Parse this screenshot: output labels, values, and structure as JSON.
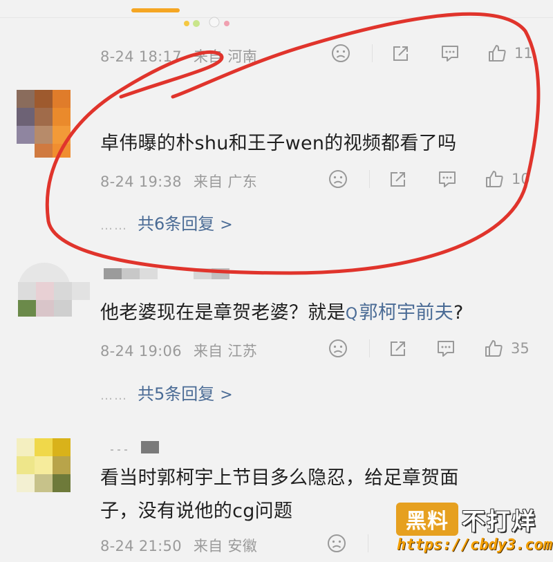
{
  "comments": [
    {
      "date": "8-24 18:17",
      "location": "来自 河南",
      "likes": "11"
    },
    {
      "text": "卓伟曝的朴shu和王子wen的视频都看了吗",
      "date": "8-24 19:38",
      "location": "来自 广东",
      "likes": "10",
      "replies": "共6条回复"
    },
    {
      "text_before": "他老婆现在是章贺老婆？就是",
      "linked_name": "郭柯宇前夫",
      "text_after": "?",
      "date": "8-24 19:06",
      "location": "来自 江苏",
      "likes": "35",
      "replies": "共5条回复"
    },
    {
      "text_line1": "看当时郭柯宇上节目多么隐忍，给足章贺面",
      "text_line2": "子，没有说他的cg问题",
      "date": "8-24 21:50",
      "location": "来自 安徽"
    }
  ],
  "reply_dots": "……",
  "reply_chevron": ">",
  "search_glyph": "Q",
  "watermark": {
    "badge": "黑料",
    "text": "不打烊",
    "url": "https://cbdy3.com"
  },
  "icons": [
    "dislike-face-icon",
    "share-icon",
    "comment-icon",
    "thumbs-up-icon"
  ],
  "colors": {
    "background": "#f2f2f2",
    "link": "#4a6b95",
    "meta": "#9a9a9a",
    "annotation": "#e0342c",
    "watermark": "#e6a020"
  }
}
